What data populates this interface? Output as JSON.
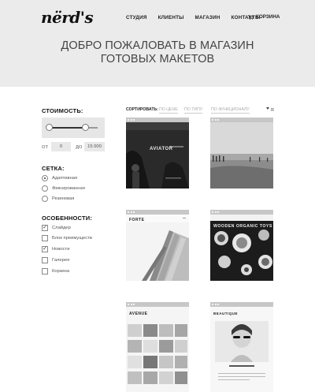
{
  "header": {
    "logo": "nërd's",
    "nav": [
      "СТУДИЯ",
      "КЛИЕНТЫ",
      "МАГАЗИН",
      "КОНТАКТЫ"
    ],
    "cart_label": "КОРЗИНА",
    "title_line1": "ДОБРО ПОЖАЛОВАТЬ В МАГАЗИН",
    "title_line2": "ГОТОВЫХ МАКЕТОВ"
  },
  "filters": {
    "price": {
      "heading": "СТОИМОСТЬ:",
      "from_label": "ОТ",
      "from_value": "0",
      "to_label": "ДО",
      "to_value": "15 000",
      "range_fraction": [
        0.0,
        0.75
      ]
    },
    "grid": {
      "heading": "СЕТКА:",
      "options": [
        "Адаптивная",
        "Фиксированная",
        "Резиновая"
      ],
      "selected_index": 0
    },
    "features": {
      "heading": "ОСОБЕННОСТИ:",
      "options": [
        "Слайдер",
        "Блок преимуществ",
        "Новости",
        "Галерея",
        "Корзина"
      ],
      "checked": [
        true,
        false,
        true,
        false,
        false
      ]
    }
  },
  "sort": {
    "label": "СОРТИРОВАТЬ:",
    "options": [
      "ПО ЦЕНЕ",
      "ПО ТИПУ",
      "ПО ФУНКЦИОНАЛУ"
    ]
  },
  "products": [
    {
      "caption": "AVIATOR"
    },
    {
      "caption": ""
    },
    {
      "caption": "FORTE"
    },
    {
      "caption": "WOODEN ORGANIC TOYS"
    },
    {
      "caption": "AVENUE"
    },
    {
      "caption": "BEAUTIQUE"
    }
  ],
  "icons": {
    "cart": "cart-icon",
    "view": "grid-view-icon"
  }
}
